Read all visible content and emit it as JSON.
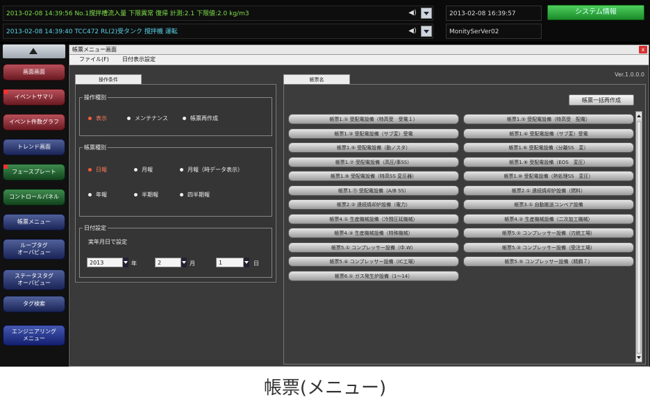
{
  "top": {
    "alarm1": "2013-02-08 14:39:56 No.1撹拌槽流入量 下限異常 復帰 計測:2.1 下限値:2.0 kg/m3",
    "alarm2": "2013-02-08 14:39:40 TCC472 RL(2)受タンク 撹拌機 運転",
    "datetime": "2013-02-08 16:39:57",
    "server": "MonitySerVer02",
    "system_button": "システム情報",
    "speaker_icon": "speaker-icon"
  },
  "nav": {
    "items": [
      {
        "label": "画面画面",
        "style": "red"
      },
      {
        "label": "イベントサマリ",
        "style": "red",
        "flag": true
      },
      {
        "label": "イベント件数グラフ",
        "style": "red"
      },
      {
        "label": "トレンド画面",
        "style": "navy"
      },
      {
        "label": "フェースプレート",
        "style": "green",
        "flag": true
      },
      {
        "label": "コントロールパネル",
        "style": "green"
      },
      {
        "label": "帳票メニュー",
        "style": "navy"
      },
      {
        "label": "ループタグ\nオーバビュー",
        "style": "navy"
      },
      {
        "label": "ステータスタグ\nオーバビュー",
        "style": "navy"
      },
      {
        "label": "タグ検索",
        "style": "navy"
      },
      {
        "label": "エンジニアリング\nメニュー",
        "style": "blue"
      }
    ]
  },
  "window": {
    "title": "帳票メニュー画面",
    "menu": [
      "ファイル(F)",
      "日付表示設定"
    ],
    "version": "Ver.1.0.0.0",
    "close": "x"
  },
  "left": {
    "tab": "操作条件",
    "op_type": {
      "label": "操作種別",
      "options": [
        {
          "label": "表示",
          "selected": true
        },
        {
          "label": "メンテナンス",
          "selected": false
        },
        {
          "label": "帳票再作成",
          "selected": false
        }
      ]
    },
    "report_type": {
      "label": "帳票種別",
      "options": [
        {
          "label": "日報",
          "selected": true
        },
        {
          "label": "月報",
          "selected": false
        },
        {
          "label": "月報（時データ表示）",
          "selected": false
        },
        {
          "label": "年報",
          "selected": false
        },
        {
          "label": "半期報",
          "selected": false
        },
        {
          "label": "四半期報",
          "selected": false
        }
      ]
    },
    "date": {
      "label": "日付設定",
      "sub": "実年月日で設定",
      "year": "2013",
      "year_unit": "年",
      "month": "2",
      "month_unit": "月",
      "day": "1",
      "day_unit": "日"
    }
  },
  "right": {
    "tab": "帳票名",
    "list_button": "帳票一括再作成",
    "col1": [
      "帳票1.① 受配電設備（特高受　受電１）",
      "帳票1.③ 受配電設備（サブ変）受電",
      "帳票1.⑤ 受配電設備（動ノスタ）",
      "帳票1.⑦ 受配電設備（高圧/事SS）",
      "帳票1.⑨ 受配電設備（特高SS 変圧器）",
      "帳票1.⑪ 受配電設備（A/B SS）",
      "帳票2.② 連続焼却炉設備（電力）",
      "帳票4.① 生産機械設備（冷間圧延機械）",
      "帳票4.③ 生産機械設備（特殊機械）",
      "帳票5.① コンプレッサー設備（中.W）",
      "帳票5.④ コンプレッサー設備（IC工場）",
      "帳票6.① ガス発生炉設備（1～14）"
    ],
    "col2": [
      "帳票1.② 受配電設備（特高受　配電）",
      "帳票1.④ 受配電設備（サブ変）受電",
      "帳票1.⑥ 受配電設備（分離SS　変）",
      "帳票1.⑧ 受配電設備（EOS　変圧）",
      "帳票1.⑩ 受配電設備（熱処理SS　変圧）",
      "帳票2.① 連続焼却炉設備（燃料）",
      "帳票3.① 自動搬送コンベア設備",
      "帳票4.② 生産機械設備（二次加工機械）",
      "帳票5.② コンプレッサー設備（刃統工場）",
      "帳票5.③ コンプレッサー設備（受注工場）",
      "帳票5.⑤ コンプレッサー設備（精鋼７）"
    ]
  },
  "caption": "帳票(メニュー)"
}
